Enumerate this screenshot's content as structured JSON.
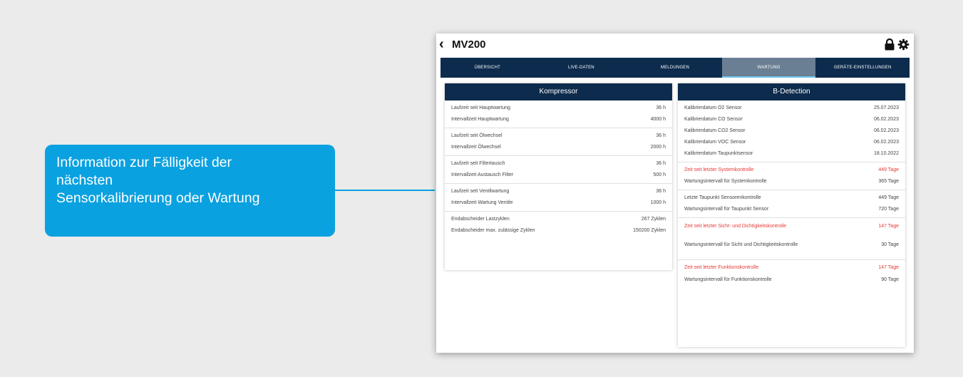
{
  "callout": {
    "lines": [
      "Information zur Fälligkeit der",
      "nächsten",
      "Sensorkalibrierung oder Wartung"
    ]
  },
  "app": {
    "back_icon": "chevron-left-icon",
    "title": "MV200",
    "icons": [
      "lock-icon",
      "gear-icon"
    ]
  },
  "tabs": [
    {
      "label": "ÜBERSICHT"
    },
    {
      "label": "LIVE-DATEN"
    },
    {
      "label": "MELDUNGEN"
    },
    {
      "label": "WARTUNG",
      "active": true
    },
    {
      "label": "GERÄTE-EINSTELLUNGEN"
    }
  ],
  "kompressor": {
    "title": "Kompressor",
    "groups": [
      {
        "rows": [
          {
            "label": "Laufzeit seit Hauptwartung",
            "value": "36 h"
          },
          {
            "label": "Intervallzeit Hauptwartung",
            "value": "4000 h"
          }
        ]
      },
      {
        "rows": [
          {
            "label": "Laufzeit seit Ölwechsel",
            "value": "36 h"
          },
          {
            "label": "Intervallzeit Ölwechsel",
            "value": "2000 h"
          }
        ]
      },
      {
        "rows": [
          {
            "label": "Laufzeit seit Filtertausch",
            "value": "36 h"
          },
          {
            "label": "Intervallzeit Austausch Filter",
            "value": "500 h"
          }
        ]
      },
      {
        "rows": [
          {
            "label": "Laufzeit seit Ventilwartung",
            "value": "36 h"
          },
          {
            "label": "Intervallzeit Wartung Ventile",
            "value": "1000 h"
          }
        ]
      },
      {
        "rows": [
          {
            "label": "Endabscheider Lastzyklen",
            "value": "267 Zyklen"
          },
          {
            "label": "Endabscheider max. zulässige Zyklen",
            "value": "150200 Zyklen"
          }
        ]
      }
    ]
  },
  "bdetection": {
    "title": "B-Detection",
    "groups": [
      {
        "rows": [
          {
            "label": "Kalibrierdatum O2 Sensor",
            "value": "25.07.2023"
          },
          {
            "label": "Kalibrierdatum CO Sensor",
            "value": "06.02.2023"
          },
          {
            "label": "Kalibrierdatum CO2 Sensor",
            "value": "06.02.2023"
          },
          {
            "label": "Kalibrierdatum VOC Sensor",
            "value": "06.02.2023"
          },
          {
            "label": "Kalibrierdatum Taupunktsensor",
            "value": "18.10.2022"
          }
        ]
      },
      {
        "rows": [
          {
            "label": "Zeit seit letzter Systemkontrolle",
            "value": "449 Tage",
            "alert": true
          },
          {
            "label": "Wartungsintervall für Systemkontrolle",
            "value": "365 Tage"
          }
        ]
      },
      {
        "rows": [
          {
            "label": "Letzte Taupunkt Sensorenkontrolle",
            "value": "449 Tage"
          },
          {
            "label": "Wartungsintervall für Taupunkt Sensor",
            "value": "720 Tage"
          }
        ]
      },
      {
        "rows": [
          {
            "label": "Zeit seit letzter Sicht- und Dichtigkeitskontrolle",
            "value": "147 Tage",
            "alert": true
          },
          {
            "label": "Wartungsintervall für Sicht und Dichtigkeitskontrolle",
            "value": "30 Tage"
          }
        ]
      },
      {
        "rows": [
          {
            "label": "Zeit seit letzter Funktionskontrolle",
            "value": "147 Tage",
            "alert": true
          },
          {
            "label": "Wartungsintervall für Funktionskontrolle",
            "value": "90 Tage"
          }
        ]
      }
    ]
  },
  "colors": {
    "accent": "#0aa1e0",
    "nav_bg": "#0d2b4d",
    "tab_active": "#6b7f94",
    "alert": "#e53935"
  }
}
